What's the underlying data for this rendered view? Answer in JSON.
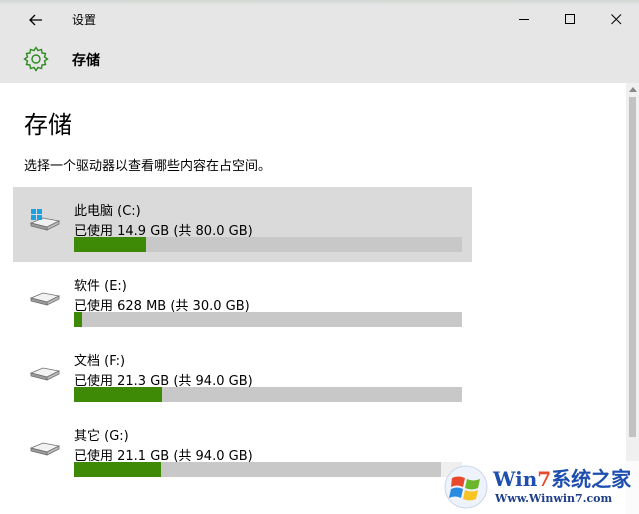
{
  "window": {
    "title": "设置"
  },
  "header": {
    "title": "存储"
  },
  "page": {
    "title": "存储",
    "subtitle": "选择一个驱动器以查看哪些内容在占空间。"
  },
  "drives": [
    {
      "name": "此电脑 (C:)",
      "usage": "已使用 14.9 GB (共 80.0 GB)",
      "used_fraction": 0.186,
      "system": true,
      "selected": true
    },
    {
      "name": "软件 (E:)",
      "usage": "已使用 628 MB (共 30.0 GB)",
      "used_fraction": 0.02,
      "system": false,
      "selected": false
    },
    {
      "name": "文档 (F:)",
      "usage": "已使用 21.3 GB (共 94.0 GB)",
      "used_fraction": 0.227,
      "system": false,
      "selected": false
    },
    {
      "name": "其它 (G:)",
      "usage": "已使用 21.1 GB (共 94.0 GB)",
      "used_fraction": 0.224,
      "system": false,
      "selected": false
    }
  ],
  "colors": {
    "bar_fill": "#3e8a07",
    "bar_track": "#c8c8c8",
    "header_bg": "#e6e6e6",
    "selected_bg": "#dadada",
    "gear_accent": "#2e8b1f"
  },
  "watermark": {
    "brand_w": "W",
    "brand_in": "in",
    "brand_7": "7",
    "brand_cn": "系统之家",
    "url": "Www.Winwin7.com"
  }
}
